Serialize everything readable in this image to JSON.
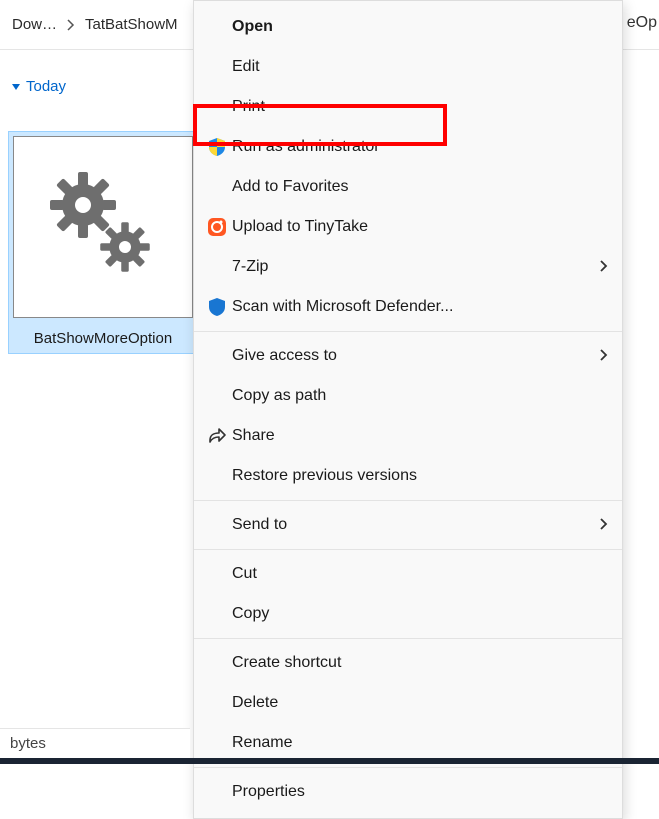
{
  "breadcrumb": {
    "crumb1": "Dow…",
    "crumb2": "TatBatShowM"
  },
  "right_edge": "eOp",
  "section": {
    "label": "Today"
  },
  "file": {
    "name": "BatShowMoreOption"
  },
  "status": {
    "text": "bytes"
  },
  "menu": {
    "open": "Open",
    "edit": "Edit",
    "print": "Print",
    "run_admin": "Run as administrator",
    "add_fav": "Add to Favorites",
    "upload_tinytake": "Upload to TinyTake",
    "seven_zip": "7-Zip",
    "scan_defender": "Scan with Microsoft Defender...",
    "give_access": "Give access to",
    "copy_path": "Copy as path",
    "share": "Share",
    "restore": "Restore previous versions",
    "send_to": "Send to",
    "cut": "Cut",
    "copy": "Copy",
    "shortcut": "Create shortcut",
    "delete": "Delete",
    "rename": "Rename",
    "properties": "Properties"
  }
}
